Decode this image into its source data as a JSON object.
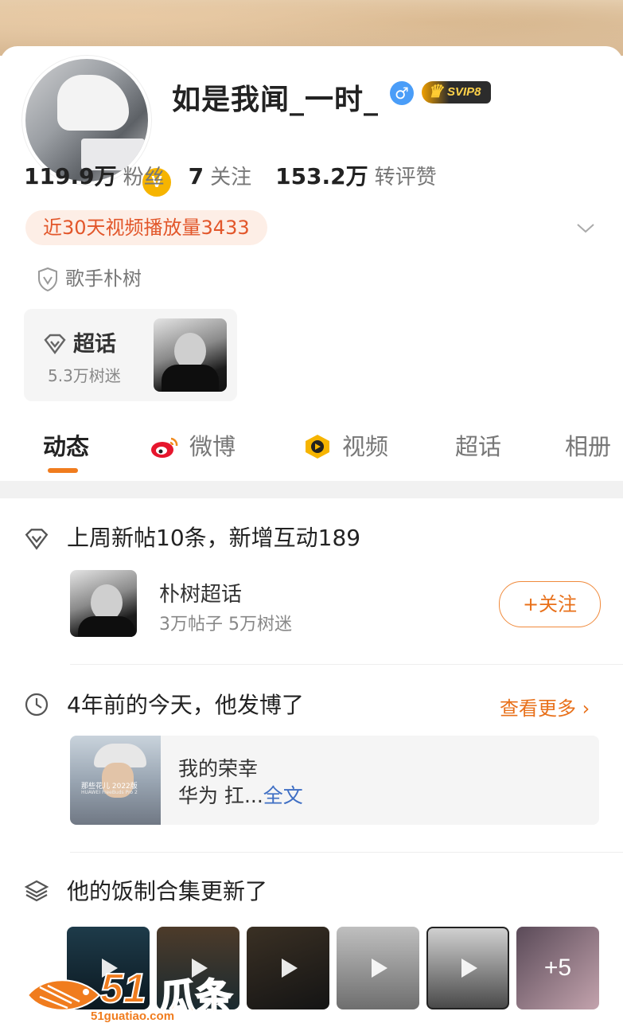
{
  "profile": {
    "name": "如是我闻_一时_",
    "gender": "♂",
    "verified": "V",
    "vip": "SVIP8",
    "stats": [
      {
        "num": "119.9万",
        "label": "粉丝"
      },
      {
        "num": "7",
        "label": "关注"
      },
      {
        "num": "153.2万",
        "label": "转评赞"
      }
    ],
    "video_pill": "近30天视频播放量3433",
    "tag": "歌手朴树"
  },
  "chaohua_card": {
    "title": "超话",
    "sub": "5.3万树迷"
  },
  "tabs": [
    "动态",
    "微博",
    "视频",
    "超话",
    "相册"
  ],
  "sections": {
    "weekly": "上周新帖10条，新增互动189",
    "community": {
      "title": "朴树超话",
      "sub": "3万帖子 5万树迷",
      "follow": "+关注"
    },
    "memory": {
      "title": "4年前的今天，他发博了",
      "more": "查看更多",
      "line1": "我的荣幸",
      "line2_prefix": "华为 扛...",
      "line2_link": "全文",
      "thumb_caption": "那些花儿 2022版",
      "thumb_sub": "HUAWEI FreeBuds Pro 2"
    },
    "collection": {
      "title": "他的饭制合集更新了",
      "more_count": "+5"
    }
  },
  "watermark": {
    "num": "51",
    "cn": "瓜条",
    "url": "51guatiao.com"
  },
  "colors": {
    "accent": "#f07c1e",
    "link": "#3f6fc4"
  }
}
